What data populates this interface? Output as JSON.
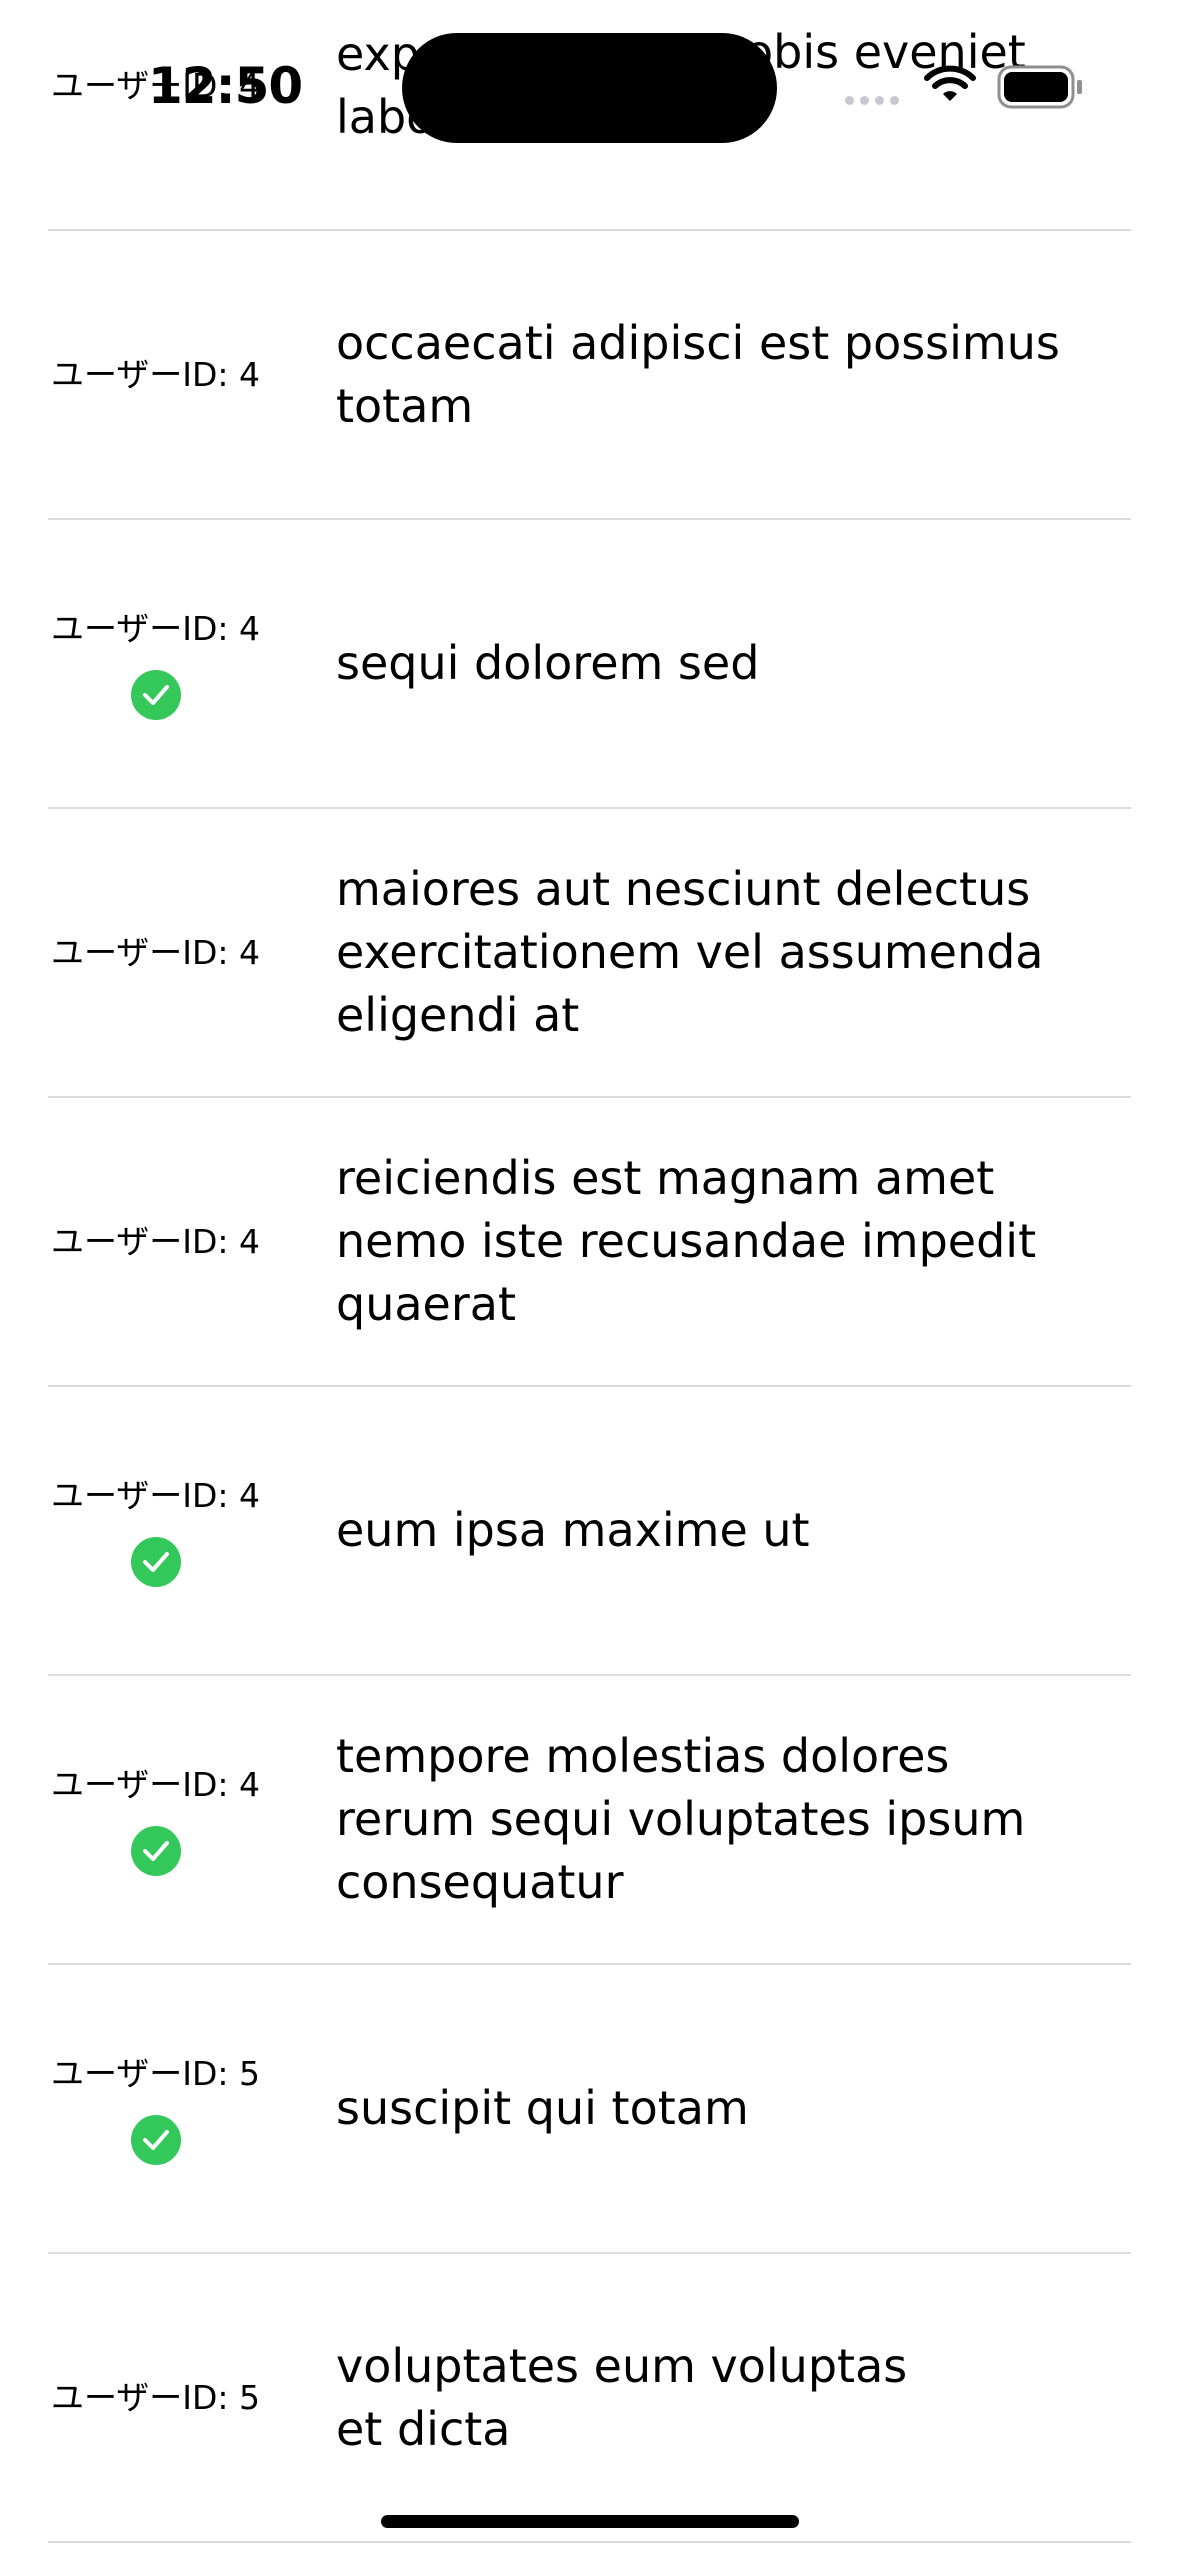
{
  "status_bar": {
    "time": "12:50",
    "icons": [
      "signal-dots-icon",
      "wifi-icon",
      "battery-icon"
    ]
  },
  "colors": {
    "check": "#34c759",
    "divider": "#dcdcdf",
    "text": "#000000",
    "background": "#ffffff"
  },
  "rows": [
    {
      "user_id": "ユーザーID: 4",
      "completed": false,
      "title_lines": [
        "exp",
        "labo"
      ],
      "title_right": "obis eveniet"
    },
    {
      "user_id": "ユーザーID: 4",
      "completed": false,
      "title_lines": [
        "occaecati adipisci est possimus",
        "totam"
      ]
    },
    {
      "user_id": "ユーザーID: 4",
      "completed": true,
      "title_lines": [
        "sequi dolorem sed"
      ]
    },
    {
      "user_id": "ユーザーID: 4",
      "completed": false,
      "title_lines": [
        "maiores aut nesciunt delectus",
        "exercitationem vel assumenda",
        "eligendi at"
      ]
    },
    {
      "user_id": "ユーザーID: 4",
      "completed": false,
      "title_lines": [
        "reiciendis est magnam amet",
        "nemo iste recusandae impedit",
        "quaerat"
      ]
    },
    {
      "user_id": "ユーザーID: 4",
      "completed": true,
      "title_lines": [
        "eum ipsa maxime ut"
      ]
    },
    {
      "user_id": "ユーザーID: 4",
      "completed": true,
      "title_lines": [
        "tempore molestias dolores",
        "rerum sequi voluptates ipsum",
        "consequatur"
      ]
    },
    {
      "user_id": "ユーザーID: 5",
      "completed": true,
      "title_lines": [
        "suscipit qui totam"
      ]
    },
    {
      "user_id": "ユーザーID: 5",
      "completed": false,
      "title_lines": [
        "voluptates eum voluptas",
        "et dicta"
      ]
    }
  ]
}
